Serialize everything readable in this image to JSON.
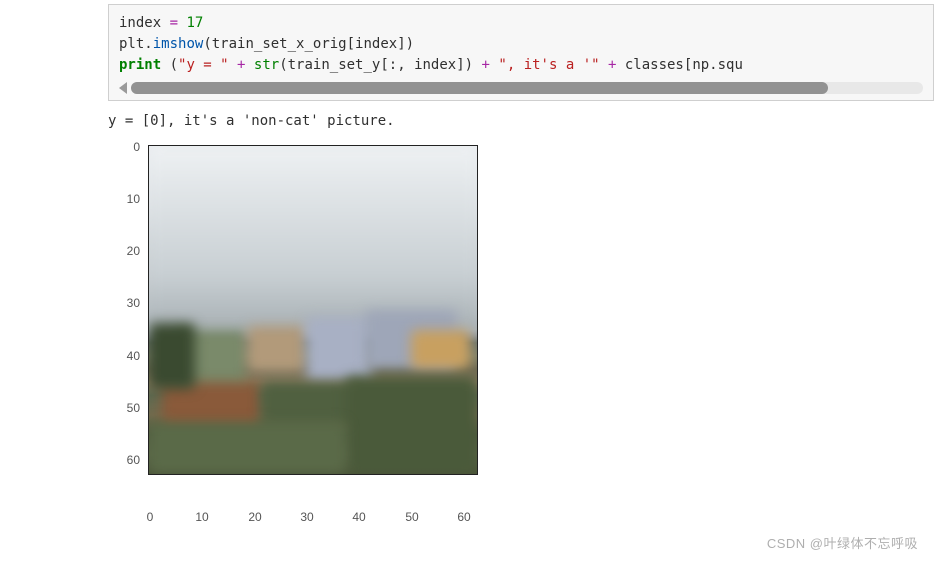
{
  "code": {
    "tokens": {
      "index_name": "index",
      "eq": "=",
      "index_val": "17",
      "plt": "plt",
      "dot": ".",
      "imshow": "imshow",
      "lparen": "(",
      "rparen": ")",
      "train_x": "train_set_x_orig",
      "lbrack": "[",
      "rbrack": "]",
      "indexvar": "index",
      "print": "print",
      "space_paren": " (",
      "str1": "\"y = \"",
      "plus": " + ",
      "strfn": "str",
      "train_y": "train_set_y",
      "colon_all": ":, ",
      "str2": "\", it's a '\"",
      "classes": "classes",
      "np": "np",
      "squ": "squ"
    }
  },
  "output": {
    "line1": "y = [0], it's a 'non-cat' picture."
  },
  "chart_data": {
    "type": "heatmap",
    "title": "",
    "xlabel": "",
    "ylabel": "",
    "xlim": [
      0,
      63
    ],
    "ylim": [
      0,
      63
    ],
    "x_ticks": [
      0,
      10,
      20,
      30,
      40,
      50,
      60
    ],
    "y_ticks": [
      0,
      10,
      20,
      30,
      40,
      50,
      60
    ],
    "note": "64×64 RGB image from train_set_x_orig[17]; pixel data approximated visually (sky/clouds upper half, cityscape and vegetation lower half)."
  },
  "watermark": "CSDN @叶绿体不忘呼吸"
}
